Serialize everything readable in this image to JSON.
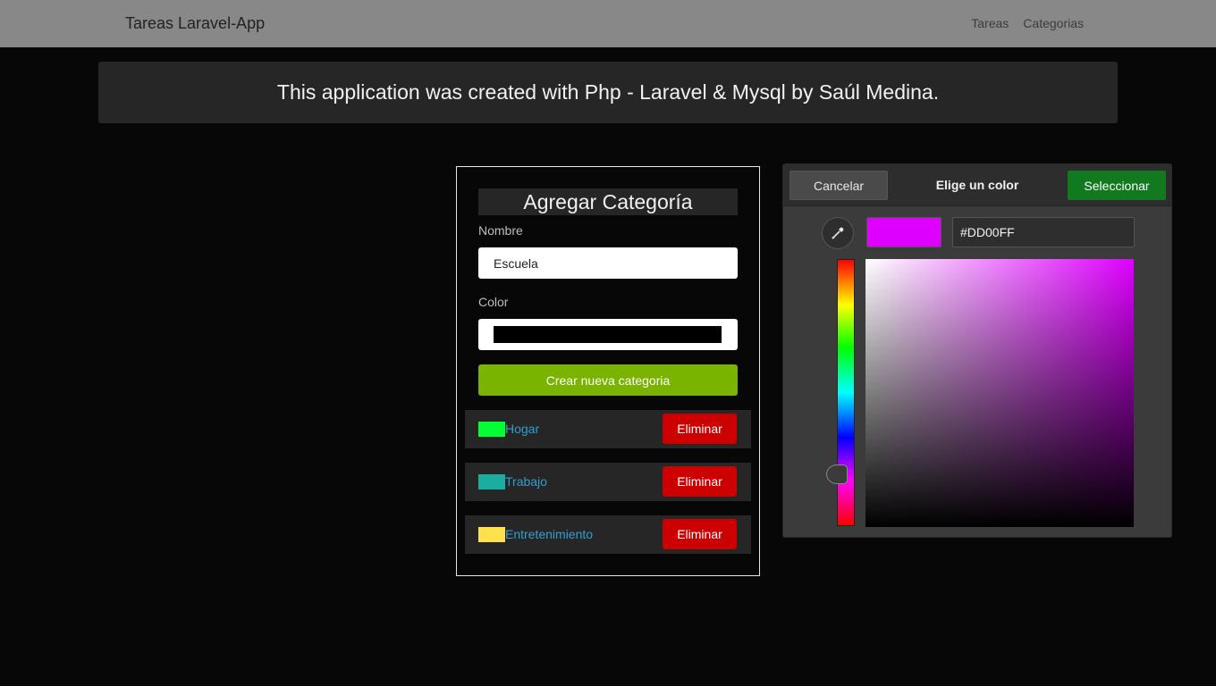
{
  "navbar": {
    "brand": "Tareas Laravel-App",
    "links": [
      "Tareas",
      "Categorias"
    ]
  },
  "banner": {
    "text": "This application was created with Php - Laravel & Mysql by Saúl Medina."
  },
  "form": {
    "title": "Agregar Categoría",
    "name_label": "Nombre",
    "name_value": "Escuela",
    "color_label": "Color",
    "color_value": "#000000",
    "submit_label": "Crear nueva categoria"
  },
  "categories": [
    {
      "name": "Hogar",
      "color": "#00ff33",
      "delete_label": "Eliminar"
    },
    {
      "name": "Trabajo",
      "color": "#1aaea0",
      "delete_label": "Eliminar"
    },
    {
      "name": "Entretenimiento",
      "color": "#ffe14d",
      "delete_label": "Eliminar"
    }
  ],
  "color_picker": {
    "cancel_label": "Cancelar",
    "title": "Elige un color",
    "select_label": "Seleccionar",
    "hex_value": "#DD00FF",
    "preview_color": "#dd00ff",
    "icons": {
      "eyedropper": "eyedropper-icon"
    }
  }
}
